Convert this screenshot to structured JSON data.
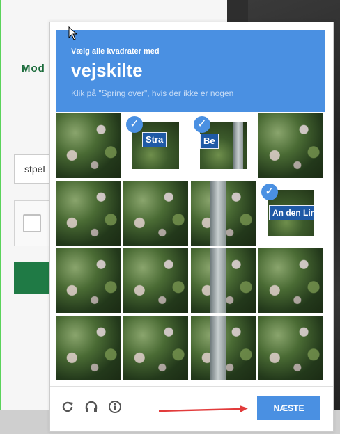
{
  "background": {
    "brand_text": "Mod",
    "input_text": "stpel"
  },
  "captcha": {
    "instruction": "Vælg alle kvadrater med",
    "target": "vejskilte",
    "hint": "Klik på \"Spring over\", hvis der ikke er nogen",
    "tiles_selected": [
      1,
      2,
      7
    ],
    "signs": {
      "tile1": "Stra",
      "tile2": "Be",
      "tile7": "An den Linden"
    },
    "footer": {
      "reload_icon": "reload-icon",
      "audio_icon": "headphones-icon",
      "info_icon": "info-icon",
      "next_label": "NÆSTE"
    }
  },
  "colors": {
    "accent": "#4a90e2",
    "arrow": "#e23b3b",
    "check": "#4a90e2"
  }
}
